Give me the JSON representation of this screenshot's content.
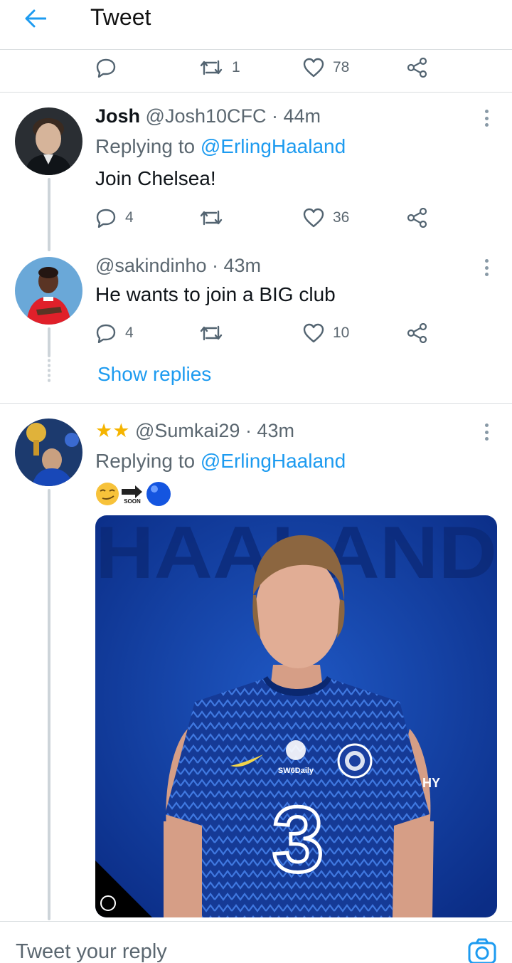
{
  "header": {
    "title": "Tweet"
  },
  "top_actions": {
    "retweets": "1",
    "likes": "78"
  },
  "tweets": [
    {
      "name": "Josh",
      "handle": "@Josh10CFC",
      "time": "· 44m",
      "replying_prefix": "Replying to",
      "replying_to": "@ErlingHaaland",
      "text": "Join Chelsea!",
      "replies": "4",
      "retweets": "",
      "likes": "36"
    },
    {
      "name": "",
      "handle": "@sakindinho",
      "time": "· 43m",
      "text": "He wants to join a BIG club",
      "replies": "4",
      "retweets": "",
      "likes": "10"
    },
    {
      "name": "★★",
      "handle": "@Sumkai29",
      "time": "· 43m",
      "replying_prefix": "Replying to",
      "replying_to": "@ErlingHaaland",
      "text": "😏➡🔵",
      "soon_label": "SOON",
      "image": {
        "watermark": "HAALAND",
        "badge_text": "SW6Daily",
        "sponsor": "3",
        "sponsor_edge": "HY"
      }
    }
  ],
  "show_replies": "Show replies",
  "reply_bar": {
    "placeholder": "Tweet your reply"
  },
  "colors": {
    "accent": "#1d9bf0",
    "text": "#0f1419",
    "muted": "#5b6770",
    "divider": "#d9dde0",
    "kit_blue": "#0a3fa8"
  }
}
